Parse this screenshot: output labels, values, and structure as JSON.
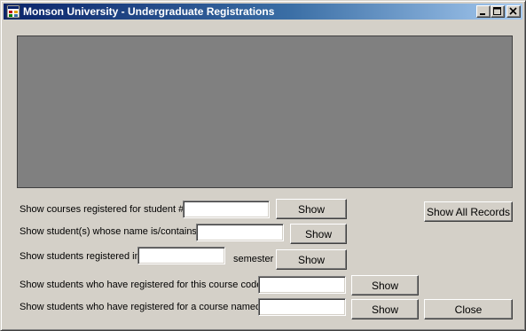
{
  "window": {
    "title": "Monson University - Undergraduate Registrations"
  },
  "titlebar_buttons": {
    "minimize_icon": "minimize-icon",
    "maximize_icon": "maximize-icon",
    "close_icon": "close-icon"
  },
  "colors": {
    "window_bg": "#d4d0c8",
    "grid_bg": "#808080",
    "title_active": "#0a246a"
  },
  "rows": {
    "student_number": {
      "label": "Show courses registered for student #:",
      "value": "",
      "button": "Show"
    },
    "student_name": {
      "label": "Show student(s) whose name is/contains",
      "value": "",
      "button": "Show"
    },
    "semester": {
      "label": "Show students registered in",
      "value": "",
      "suffix": "semester",
      "button": "Show"
    },
    "course_code": {
      "label": "Show students who have registered for this course code:",
      "value": "",
      "button": "Show"
    },
    "course_name": {
      "label": "Show students who have registered for a course named:",
      "value": "",
      "button": "Show"
    }
  },
  "actions": {
    "show_all": "Show All Records",
    "close": "Close"
  }
}
